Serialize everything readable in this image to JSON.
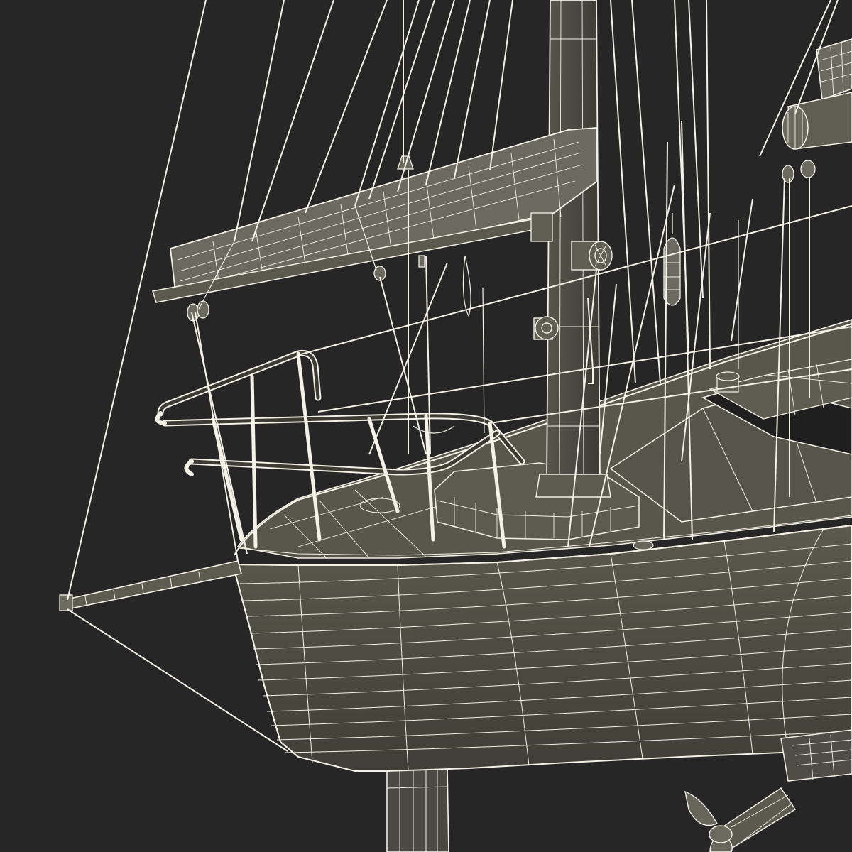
{
  "scene": {
    "kind": "3d-wireframe-render",
    "subject": "sailboat-bow",
    "colors": {
      "background": "#262626",
      "wire": "#f4f1e6",
      "hull_fill": "#545449",
      "hull_shade": "#3e3e36",
      "deck_fill": "#5a5a4f",
      "spar_fill": "#4c4c44",
      "sail_fill": "#6d6b61"
    },
    "components": [
      "hull",
      "deck",
      "mast",
      "furled-boom",
      "bowsprit",
      "pulpit-rail",
      "stays",
      "keel",
      "propeller",
      "winches",
      "blocks"
    ]
  }
}
